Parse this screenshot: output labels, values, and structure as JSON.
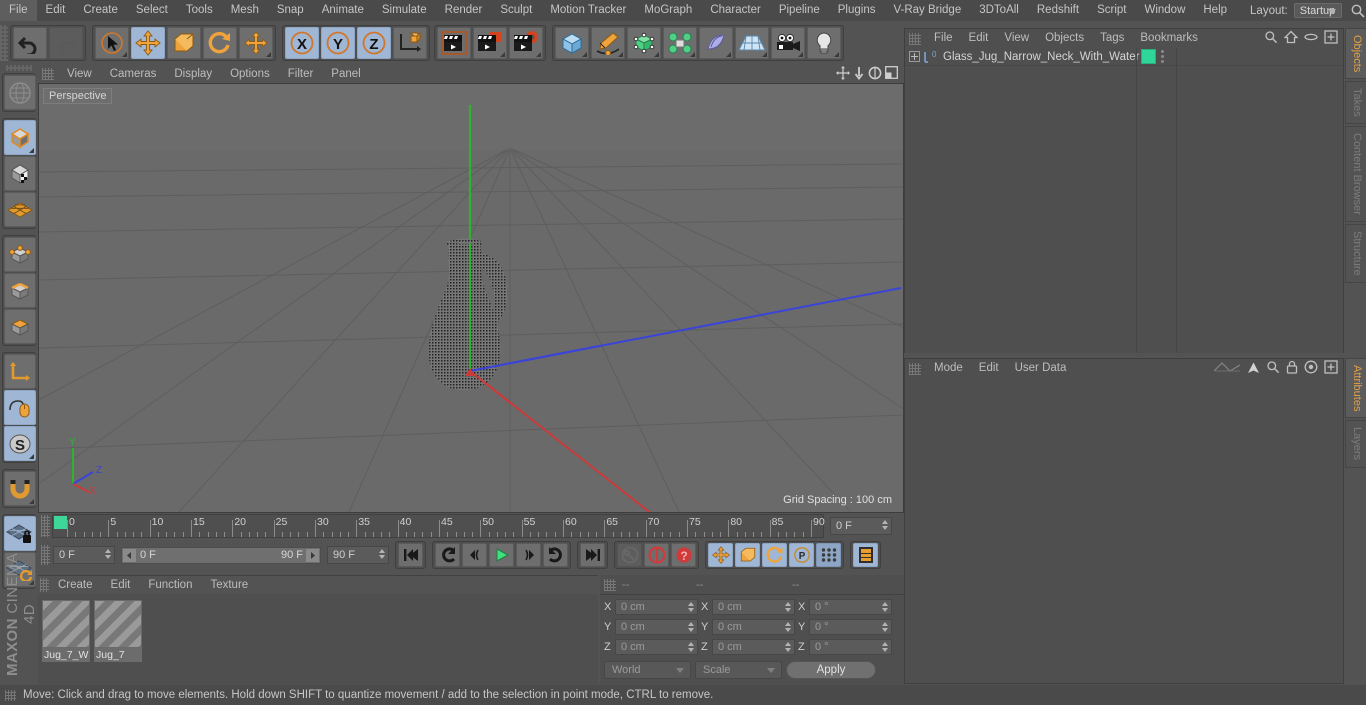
{
  "app": {
    "title": "CINEMA 4D",
    "brand_bold": "MAXON",
    "brand_rest": "CINEMA 4D"
  },
  "menubar": {
    "items": [
      "File",
      "Edit",
      "Create",
      "Select",
      "Tools",
      "Mesh",
      "Snap",
      "Animate",
      "Simulate",
      "Render",
      "Sculpt",
      "Motion Tracker",
      "MoGraph",
      "Character",
      "Pipeline",
      "Plugins",
      "V-Ray Bridge",
      "3DToAll",
      "Redshift",
      "Script",
      "Window",
      "Help"
    ],
    "layout_label": "Layout:",
    "layout_value": "Startup",
    "search_icon": "magnifier-icon"
  },
  "toolbar": {
    "undo_label": "undo-icon",
    "redo_label": "redo-icon",
    "tools": [
      "live-selection-icon",
      "move-icon",
      "scale-icon",
      "rotate-icon",
      "move-axis-icon"
    ],
    "axes": [
      "X",
      "Y",
      "Z"
    ],
    "axis_world_icon": "world-coordinates-icon",
    "render_icons": [
      "render-view-icon",
      "render-region-icon",
      "render-settings-icon"
    ],
    "object_icons": [
      "cube-primitive-icon",
      "spline-pen-icon",
      "nurbs-icon",
      "mograph-icon",
      "deformer-icon",
      "scene-floor-icon",
      "camera-icon",
      "light-icon"
    ]
  },
  "left_toolbar": {
    "groups": [
      [
        "make-editable-icon"
      ],
      [
        "model-mode-icon",
        "texture-mode-icon",
        "workplane-icon"
      ],
      [
        "points-mode-icon",
        "edges-mode-icon",
        "polygons-mode-icon"
      ],
      [
        "object-axis-icon",
        "enable-axis-icon",
        "soft-selection-icon"
      ],
      [
        "snap-icon"
      ],
      [
        "workplane-lock-icon",
        "workplane-rotate-icon"
      ]
    ]
  },
  "viewport": {
    "menu": [
      "View",
      "Cameras",
      "Display",
      "Options",
      "Filter",
      "Panel"
    ],
    "view_label": "Perspective",
    "grid_info": "Grid Spacing : 100 cm",
    "corner_icons": [
      "pan-view-icon",
      "dolly-view-icon",
      "rotate-view-icon",
      "maximize-view-icon"
    ],
    "axis_gizmo": {
      "x": "X",
      "y": "Y",
      "z": "Z"
    },
    "selected_object": "Glass_Jug_Narrow_Neck_With_Water"
  },
  "timeline": {
    "ticks": [
      "0",
      "5",
      "10",
      "15",
      "20",
      "25",
      "30",
      "35",
      "40",
      "45",
      "50",
      "55",
      "60",
      "65",
      "70",
      "75",
      "80",
      "85",
      "90"
    ],
    "current_frame_field": "0 F",
    "start_field": "0 F",
    "range_start": "0 F",
    "range_end": "90 F",
    "end_field": "90 F",
    "playback_buttons": [
      "go-to-start-icon",
      "previous-key-icon",
      "step-back-icon",
      "play-icon",
      "step-forward-icon",
      "next-key-icon",
      "go-to-end-icon"
    ],
    "record_buttons": [
      "autokey-icon",
      "record-active-objects-icon",
      "keyframe-selection-icon"
    ],
    "param_buttons": [
      "position-key-icon",
      "scale-key-icon",
      "rotation-key-icon",
      "param-key-icon",
      "point-level-animation-icon"
    ],
    "timeline_toggle": "animation-layers-icon"
  },
  "material_manager": {
    "menu": [
      "Create",
      "Edit",
      "Function",
      "Texture"
    ],
    "materials": [
      {
        "name": "Jug_7_W"
      },
      {
        "name": "Jug_7"
      }
    ]
  },
  "coordinates": {
    "headers": [
      "--",
      "--",
      "--"
    ],
    "rows": [
      {
        "axis": "X",
        "position": "0 cm",
        "size": "0 cm",
        "rotation": "0 °"
      },
      {
        "axis": "Y",
        "position": "0 cm",
        "size": "0 cm",
        "rotation": "0 °"
      },
      {
        "axis": "Z",
        "position": "0 cm",
        "size": "0 cm",
        "rotation": "0 °"
      }
    ],
    "coord_system": "World",
    "size_mode": "Scale",
    "apply_label": "Apply"
  },
  "object_manager": {
    "menu": [
      "File",
      "Edit",
      "View",
      "Objects",
      "Tags",
      "Bookmarks"
    ],
    "icons": [
      "search-icon",
      "home-icon",
      "ellipse-icon",
      "add-layer-icon"
    ],
    "objects": [
      {
        "name": "Glass_Jug_Narrow_Neck_With_Water",
        "tag_color": "#2fd69a",
        "level_badge": "0"
      }
    ]
  },
  "attribute_manager": {
    "menu": [
      "Mode",
      "Edit",
      "User Data"
    ],
    "icons": [
      "interpolation-icon",
      "arrow-up-icon",
      "search-icon",
      "lock-icon",
      "target-icon",
      "add-icon"
    ]
  },
  "vertical_tabs": {
    "top": [
      {
        "label": "Objects",
        "active": true
      },
      {
        "label": "Takes",
        "active": false
      },
      {
        "label": "Content Browser",
        "active": false
      },
      {
        "label": "Structure",
        "active": false
      }
    ],
    "bottom": [
      {
        "label": "Attributes",
        "active": true
      },
      {
        "label": "Layers",
        "active": false
      }
    ]
  },
  "statusbar": {
    "message": "Move: Click and drag to move elements. Hold down SHIFT to quantize movement / add to the selection in point mode, CTRL to remove."
  },
  "colors": {
    "accent_orange": "#e0a04a",
    "active_blue": "#9fb6d4",
    "panel_bg": "#4f4f4f",
    "window_bg": "#535353",
    "menu_bg": "#4a4a4a",
    "axis_x": "#cc3333",
    "axis_y": "#33bb33",
    "axis_z": "#3344dd",
    "material_green": "#2fd69a"
  }
}
